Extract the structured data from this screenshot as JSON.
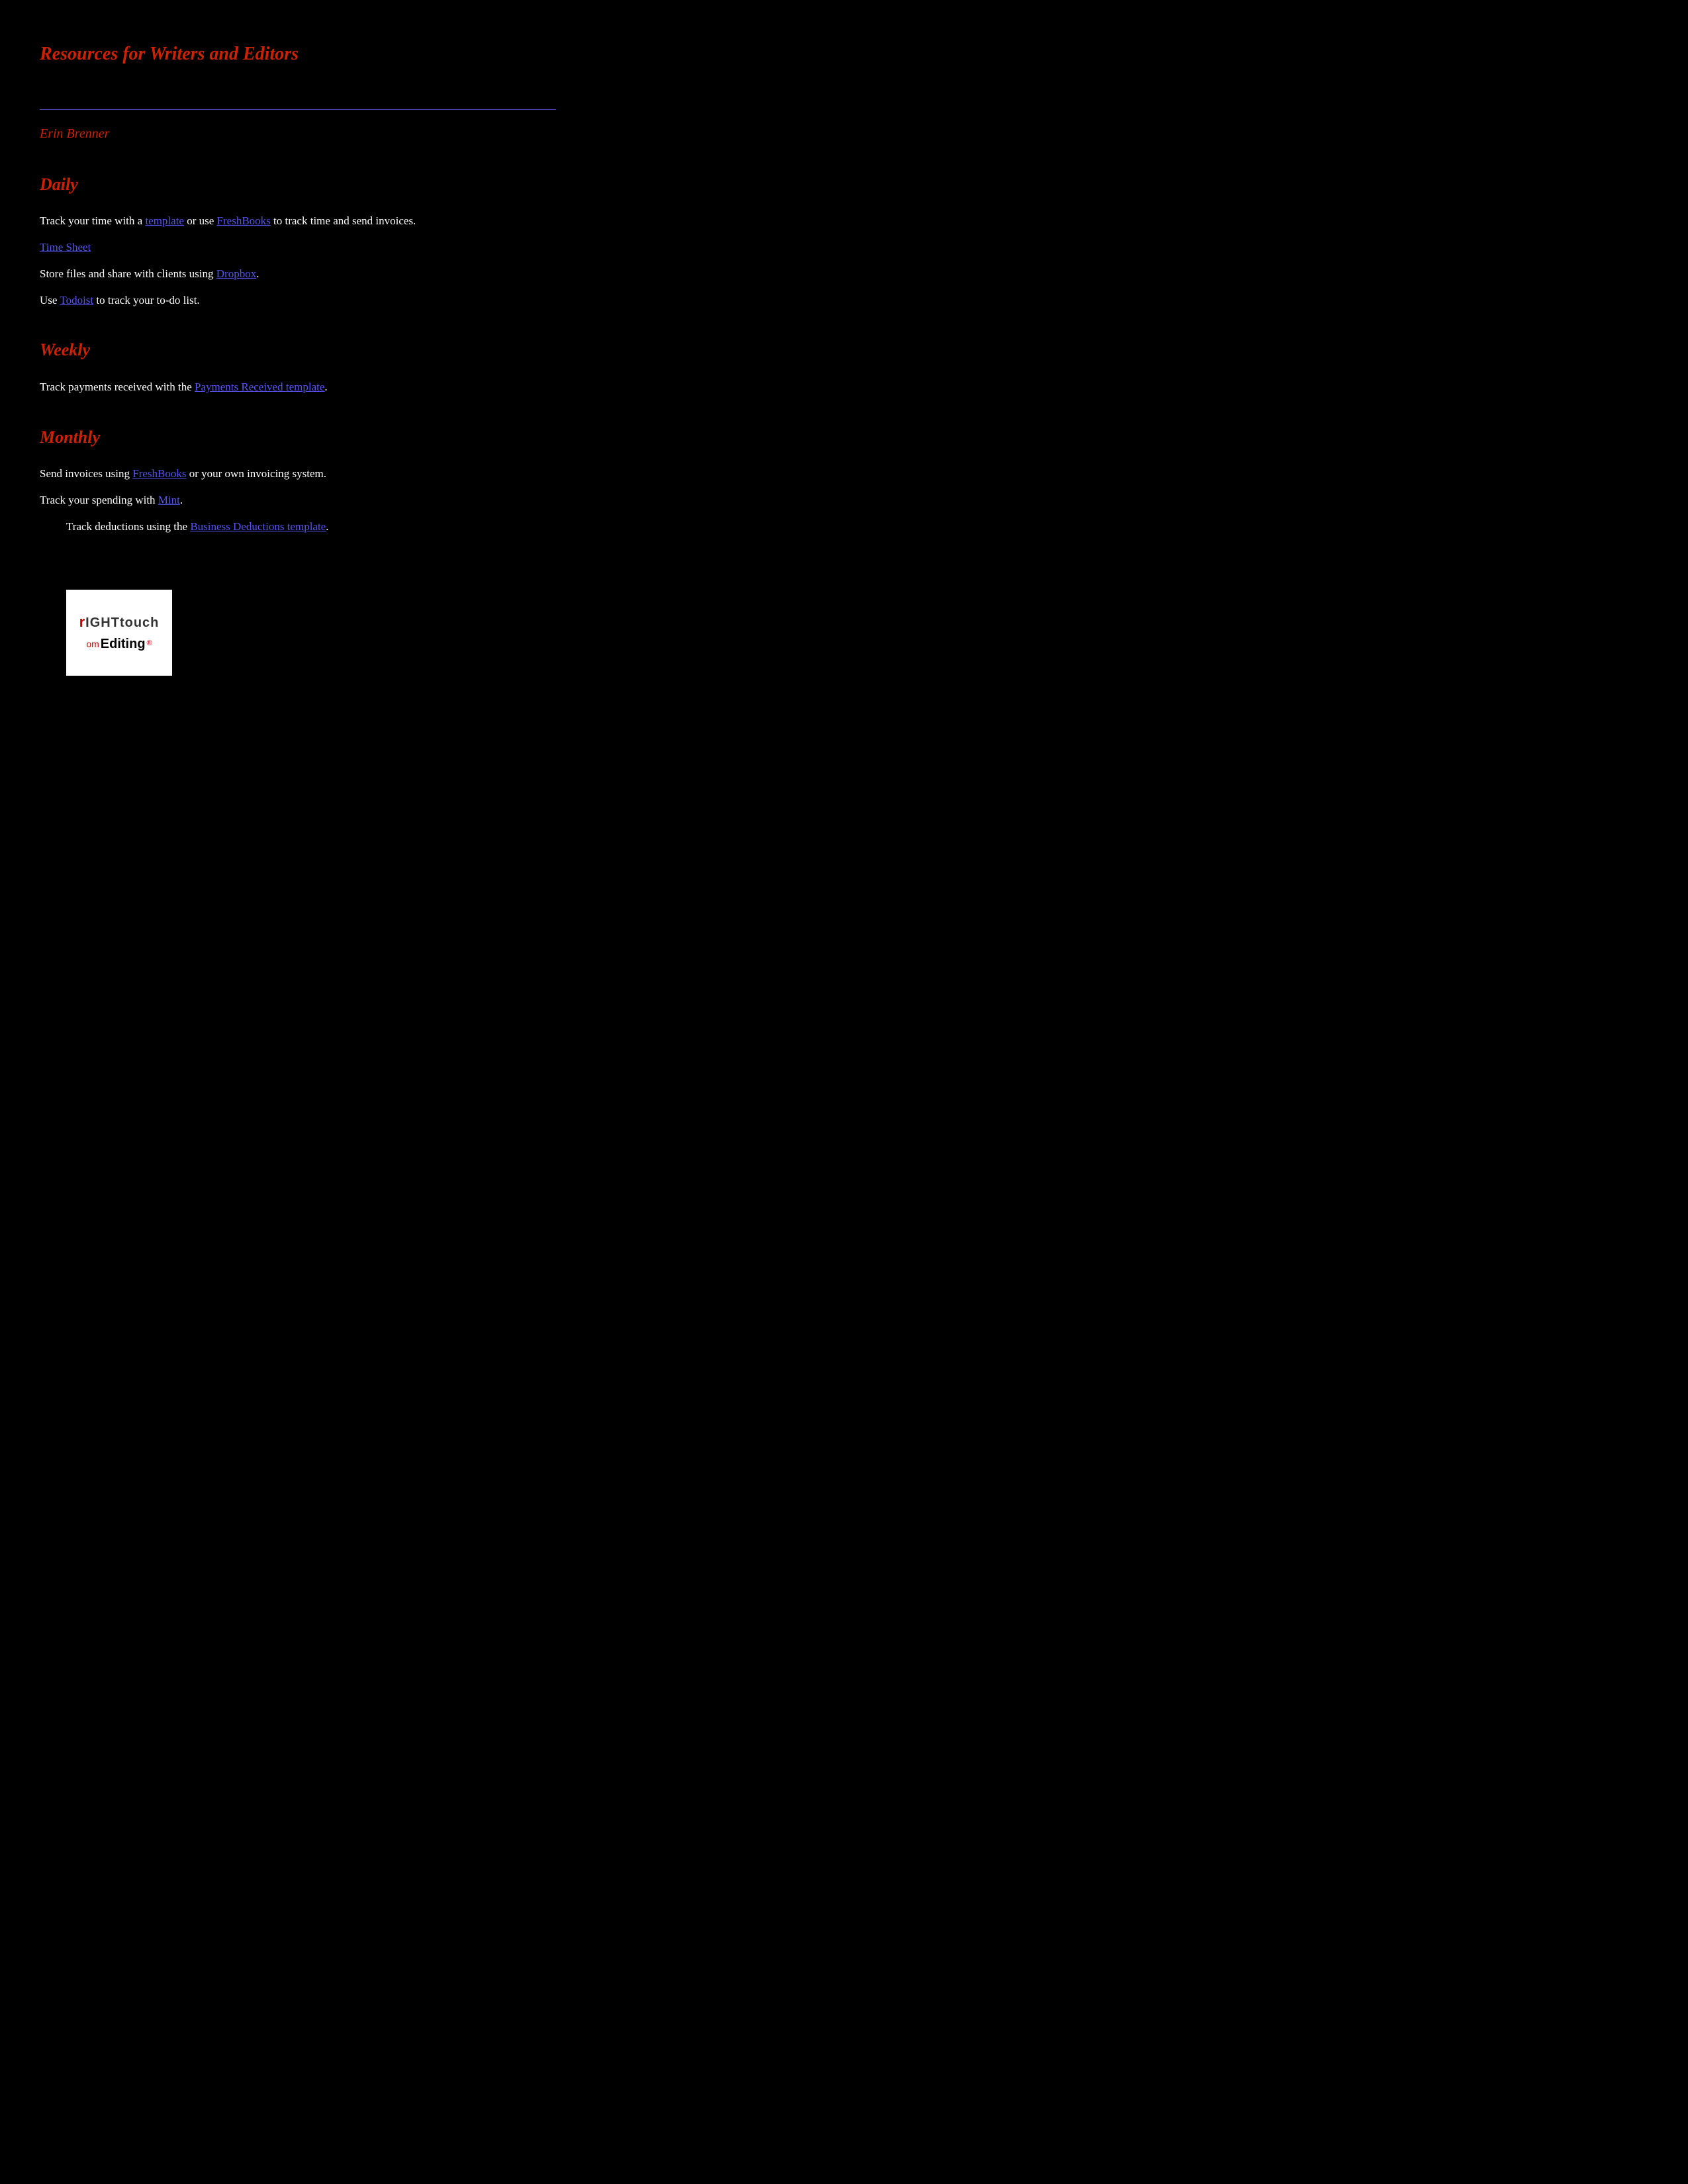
{
  "page": {
    "title": "Resources for Writers and Editors",
    "author": "Erin Brenner",
    "sections": {
      "daily": {
        "heading": "Daily",
        "content": [
          {
            "id": "daily-1",
            "text_before": "Track your time with a ",
            "link_text": "template",
            "link_href": "#template",
            "text_after": " or use"
          },
          {
            "id": "daily-2",
            "text_before": "",
            "link_text": "FreshBooks",
            "link_href": "#freshbooks",
            "text_after": " to track time and send invoices."
          },
          {
            "id": "daily-3",
            "text_before": "Store files and share with clients using ",
            "link_text": "Dropbox",
            "link_href": "#dropbox",
            "text_after": "."
          },
          {
            "id": "daily-4",
            "text_before": "Use ",
            "link_text": "Todoist",
            "link_href": "#todoist",
            "text_after": " to track your to-do list."
          },
          {
            "id": "daily-timesheet",
            "text_before": "",
            "link_text": "Time Sheet",
            "link_href": "#timesheet",
            "text_after": ""
          }
        ]
      },
      "weekly": {
        "heading": "Weekly",
        "content": [
          {
            "id": "weekly-1",
            "text_before": "Track payments received with the ",
            "link_text": "Payments Received template",
            "link_href": "#payments-received",
            "text_after": "."
          }
        ]
      },
      "monthly": {
        "heading": "Monthly",
        "content": [
          {
            "id": "monthly-1",
            "text_before": "Send invoices using ",
            "link_text": "FreshBooks",
            "link_href": "#freshbooks",
            "text_after": " or your own invoicing system."
          },
          {
            "id": "monthly-2",
            "text_before": "Track your spending with ",
            "link_text": "Mint",
            "link_href": "#mint",
            "text_after": "."
          },
          {
            "id": "monthly-3",
            "text_before": "Track deductions using the ",
            "link_text": "Business Deductions template",
            "link_href": "#business-deductions",
            "text_after": "."
          }
        ]
      }
    },
    "logo": {
      "line1_r": "r",
      "line1_rest": "IGHTtouch",
      "line2_om": "om",
      "line2_editing": "Editing",
      "line2_reg": "®"
    },
    "links": {
      "template": "template",
      "freshbooks": "FreshBooks",
      "dropbox": "Dropbox",
      "todoist": "Todoist",
      "timesheet": "Time Sheet",
      "payments_received": "Payments Received template",
      "mint": "Mint",
      "business_deductions": "Business Deductions template"
    }
  }
}
